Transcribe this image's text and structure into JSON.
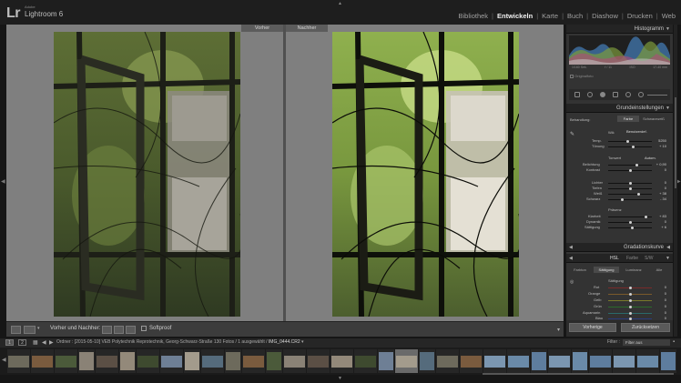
{
  "app": {
    "logo": "Lr",
    "brand_small": "Adobe",
    "brand_name": "Lightroom 6"
  },
  "modules": [
    "Bibliothek",
    "Entwickeln",
    "Karte",
    "Buch",
    "Diashow",
    "Drucken",
    "Web"
  ],
  "active_module": "Entwickeln",
  "view": {
    "before_label": "Vorher",
    "after_label": "Nachher"
  },
  "toolbar": {
    "label": "Vorher und Nachher:",
    "softproof": "Softproof"
  },
  "right_panel": {
    "histogram_title": "Histogramm",
    "histo_info": [
      "1/160 Sek.",
      "f / 11",
      "ISO",
      "17-40 mm"
    ],
    "original_photo": "Originalfoto",
    "basic_title": "Grundeinstellungen",
    "treatment_label": "Behandlung:",
    "treatment_color": "Farbe",
    "treatment_bw": "Schwarzweiß",
    "wb_label": "WA:",
    "wb_value": "Benutzerdef.",
    "temp_label": "Temp.",
    "temp_value": "5250",
    "tint_label": "Tönung",
    "tint_value": "+ 10",
    "tone_label": "Tonwert",
    "auto_label": "Autom.",
    "exposure_label": "Belichtung",
    "exposure_value": "+ 0,90",
    "contrast_label": "Kontrast",
    "contrast_value": "0",
    "highlights_label": "Lichter",
    "highlights_value": "0",
    "shadows_label": "Tiefen",
    "shadows_value": "0",
    "whites_label": "Weiß",
    "whites_value": "+ 38",
    "blacks_label": "Schwarz",
    "blacks_value": "- 34",
    "presence_label": "Präsenz",
    "clarity_label": "Klarheit",
    "clarity_value": "+ 83",
    "vibrance_label": "Dynamik",
    "vibrance_value": "0",
    "saturation_label": "Sättigung",
    "saturation_value": "+ 6",
    "tone_curve_title": "Gradationskurve",
    "hsl_tabs": [
      "HSL",
      "Farbe",
      "S/W"
    ],
    "hsl_subtabs": [
      "Farbton",
      "Sättigung",
      "Luminanz",
      "Alle"
    ],
    "hsl_section": "Sättigung",
    "hsl_colors": [
      "Rot",
      "Orange",
      "Gelb",
      "Grün",
      "Aquamarin",
      "Blau"
    ],
    "hsl_values": [
      "0",
      "0",
      "0",
      "0",
      "0",
      "0"
    ],
    "previous_button": "Vorherige",
    "reset_button": "Zurücksetzen"
  },
  "filmstrip_bar": {
    "page1": "1",
    "page2": "2",
    "path_prefix": "Ordner : [2015-05-10] VEB Polytechnik Reprotechnik, Georg-Schwarz-Straße",
    "photo_count": "130 Fotos / 1 ausgewählt /",
    "filename": "IMG_0444.CR2",
    "filter_label": "Filter :",
    "filter_value": "Filter aus"
  },
  "colors": {
    "selected_module": "#f0f0f0",
    "panel_bg": "#333333",
    "view_bg": "#7f7f7f"
  }
}
